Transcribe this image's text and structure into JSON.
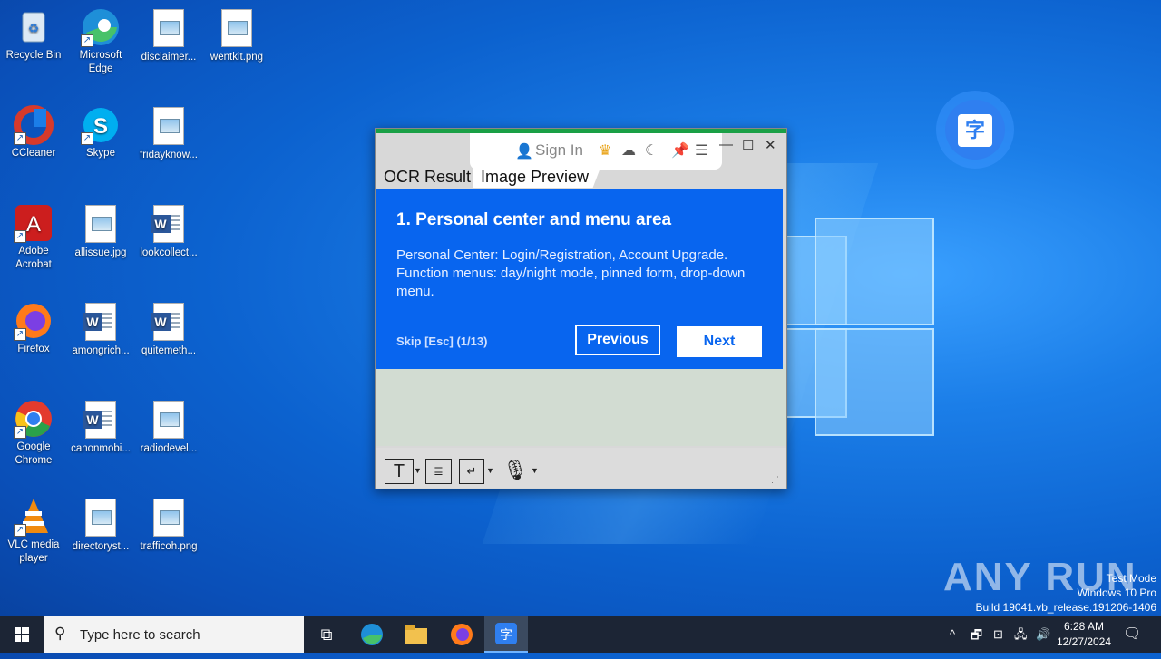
{
  "desktop": {
    "icons": [
      {
        "label": "Recycle Bin",
        "icon": "recycle-bin-icon"
      },
      {
        "label": "Microsoft Edge",
        "icon": "edge-icon"
      },
      {
        "label": "disclaimer...",
        "icon": "image-file-icon"
      },
      {
        "label": "wentkit.png",
        "icon": "image-file-icon"
      },
      {
        "label": "CCleaner",
        "icon": "ccleaner-icon"
      },
      {
        "label": "Skype",
        "icon": "skype-icon"
      },
      {
        "label": "fridayknow...",
        "icon": "image-file-icon"
      },
      {
        "label": "Adobe Acrobat",
        "icon": "acrobat-icon"
      },
      {
        "label": "allissue.jpg",
        "icon": "image-file-icon"
      },
      {
        "label": "lookcollect...",
        "icon": "word-file-icon"
      },
      {
        "label": "Firefox",
        "icon": "firefox-icon"
      },
      {
        "label": "amongrich...",
        "icon": "word-file-icon"
      },
      {
        "label": "quitemeth...",
        "icon": "word-file-icon"
      },
      {
        "label": "Google Chrome",
        "icon": "chrome-icon"
      },
      {
        "label": "canonmobi...",
        "icon": "word-file-icon"
      },
      {
        "label": "radiodevel...",
        "icon": "image-file-icon"
      },
      {
        "label": "VLC media player",
        "icon": "vlc-icon"
      },
      {
        "label": "directoryst...",
        "icon": "image-file-icon"
      },
      {
        "label": "trafficoh.png",
        "icon": "image-file-icon"
      }
    ]
  },
  "app": {
    "sign_in": "Sign In",
    "tabs": [
      "OCR Result",
      "Image Preview"
    ],
    "tour": {
      "title": "1. Personal center and menu area",
      "body": "Personal Center: Login/Registration, Account Upgrade. Function menus: day/night mode, pinned form, drop-down menu.",
      "skip": "Skip [Esc] (1/13)",
      "previous": "Previous",
      "next": "Next"
    }
  },
  "watermark": {
    "brand": "ANY RUN",
    "line1": "Test Mode",
    "line2": "Windows 10 Pro",
    "line3": "Build 19041.vb_release.191206-1406"
  },
  "taskbar": {
    "search_placeholder": "Type here to search",
    "time": "6:28 AM",
    "date": "12/27/2024"
  }
}
